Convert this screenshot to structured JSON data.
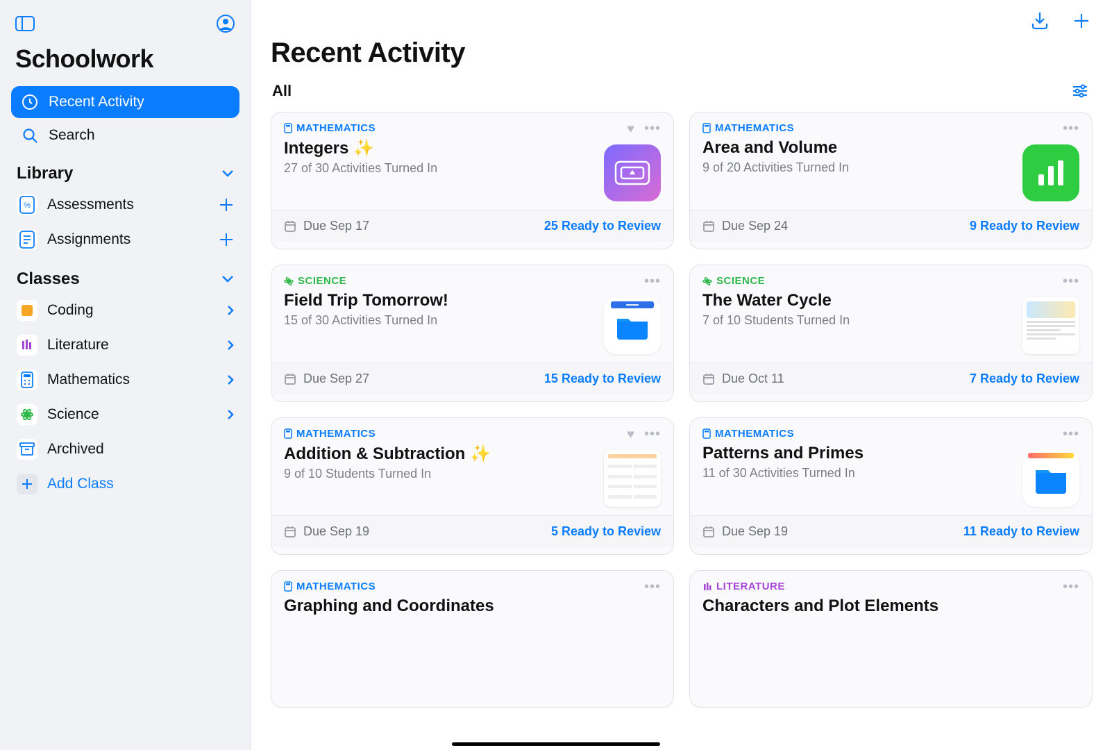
{
  "app": {
    "title": "Schoolwork"
  },
  "nav": {
    "recent": "Recent Activity",
    "search": "Search"
  },
  "library": {
    "heading": "Library",
    "assessments": "Assessments",
    "assignments": "Assignments"
  },
  "classes": {
    "heading": "Classes",
    "items": [
      {
        "label": "Coding",
        "color": "#f6a623"
      },
      {
        "label": "Literature",
        "color": "#a644d7"
      },
      {
        "label": "Mathematics",
        "color": "#0a7cff"
      },
      {
        "label": "Science",
        "color": "#2fb84a"
      }
    ],
    "archived": "Archived",
    "add": "Add Class"
  },
  "page": {
    "title": "Recent Activity",
    "filter": "All"
  },
  "cards": [
    {
      "subject": "MATHEMATICS",
      "subjectClass": "subject-math",
      "title": "Integers ✨",
      "sub": "27 of 30 Activities Turned In",
      "due": "Due Sep 17",
      "review": "25 Ready to Review",
      "heart": true,
      "thumb": "keynote"
    },
    {
      "subject": "MATHEMATICS",
      "subjectClass": "subject-math",
      "title": "Area and Volume",
      "sub": "9 of 20 Activities Turned In",
      "due": "Due Sep 24",
      "review": "9 Ready to Review",
      "heart": false,
      "thumb": "chart"
    },
    {
      "subject": "SCIENCE",
      "subjectClass": "subject-science",
      "title": "Field Trip Tomorrow!",
      "sub": "15 of 30 Activities Turned In",
      "due": "Due Sep 27",
      "review": "15 Ready to Review",
      "heart": false,
      "thumb": "folder"
    },
    {
      "subject": "SCIENCE",
      "subjectClass": "subject-science",
      "title": "The Water Cycle",
      "sub": "7 of 10 Students Turned In",
      "due": "Due Oct 11",
      "review": "7 Ready to Review",
      "heart": false,
      "thumb": "doc"
    },
    {
      "subject": "MATHEMATICS",
      "subjectClass": "subject-math",
      "title": "Addition & Subtraction ✨",
      "sub": "9 of 10 Students Turned In",
      "due": "Due Sep 19",
      "review": "5 Ready to Review",
      "heart": true,
      "thumb": "sheet"
    },
    {
      "subject": "MATHEMATICS",
      "subjectClass": "subject-math",
      "title": "Patterns and Primes",
      "sub": "11 of 30 Activities Turned In",
      "due": "Due Sep 19",
      "review": "11 Ready to Review",
      "heart": false,
      "thumb": "folder2"
    },
    {
      "subject": "MATHEMATICS",
      "subjectClass": "subject-math",
      "title": "Graphing and Coordinates",
      "sub": "",
      "due": "",
      "review": "",
      "heart": false,
      "thumb": "none"
    },
    {
      "subject": "LITERATURE",
      "subjectClass": "subject-literature",
      "title": "Characters and Plot Elements",
      "sub": "",
      "due": "",
      "review": "",
      "heart": false,
      "thumb": "none"
    }
  ]
}
